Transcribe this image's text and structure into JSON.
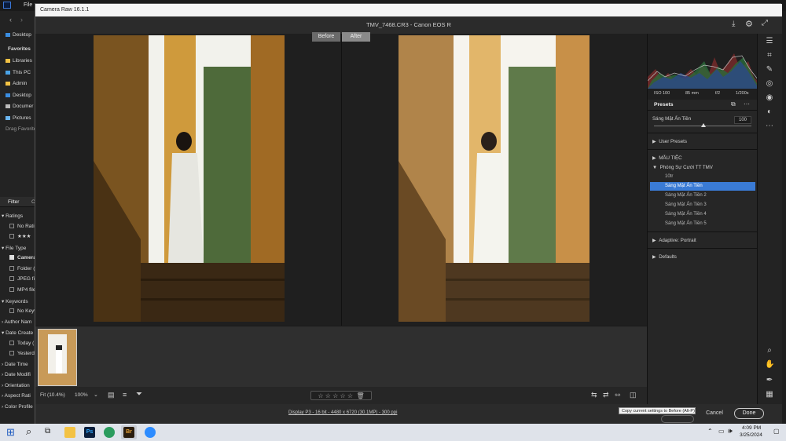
{
  "bridge": {
    "menu_file": "File",
    "favorites": {
      "heading": "Favorites",
      "desktop": "Desktop",
      "libraries": "Libraries",
      "this_pc": "This PC",
      "admin": "Admin",
      "desktop2": "Desktop",
      "documents": "Documer",
      "pictures": "Pictures",
      "drag": "Drag Favorite"
    },
    "filter": {
      "tab1": "Filter",
      "tab2": "Co",
      "ratings": "Ratings",
      "no_rating": "No Ratin",
      "stars": "★★★",
      "file_type": "File Type",
      "camera": "Camera",
      "folder": "Folder (",
      "jpeg": "JPEG fil",
      "mp4": "MP4 file",
      "keywords": "Keywords",
      "no_keyw": "No Keyw",
      "author": "Author Nam",
      "date_created": "Date Create",
      "today": "Today (",
      "yesterday": "Yesterd",
      "date_time": "Date Time",
      "date_mod": "Date Modifi",
      "orientation": "Orientation",
      "aspect": "Aspect Rati",
      "color_profile": "Color Profile"
    }
  },
  "camera_raw": {
    "window_title": "Camera Raw 16.1.1",
    "file_header": "TMV_7468.CR3  -  Canon EOS R",
    "before_label": "Before",
    "after_label": "After",
    "histogram_info": {
      "iso": "ISO 100",
      "focal": "85 mm",
      "aperture": "f/2",
      "shutter": "1/200s"
    },
    "presets": {
      "title": "Presets",
      "slider_name": "Sáng Mặt Ấn Tiền",
      "slider_value": "100",
      "slider_fraction": 1.0,
      "user_presets": "User Presets",
      "mau_tiec": "MẪU TIỆC",
      "group": "Phóng Sự Cưới TT TMV",
      "items": [
        "10tr",
        "Sáng Mặt Ấn Tiền",
        "Sáng Mặt Ấn Tiền 2",
        "Sáng Mặt Ấn Tiền 3",
        "Sáng Mặt Ấn Tiền 4",
        "Sáng Mặt Ấn Tiền 5"
      ],
      "adaptive": "Adaptive: Portrait",
      "defaults": "Defaults"
    },
    "zoom_fit": "Fit (10.4%)",
    "zoom_100": "100%",
    "status_link": "Display P3 - 16 bit - 4480 x 6720 (30.1MP) - 300 ppi",
    "tooltip": "Copy current settings to Before (Alt-P)",
    "cancel_label": "Cancel",
    "done_label": "Done"
  },
  "taskbar": {
    "time": "4:09 PM",
    "date": "3/25/2024"
  }
}
